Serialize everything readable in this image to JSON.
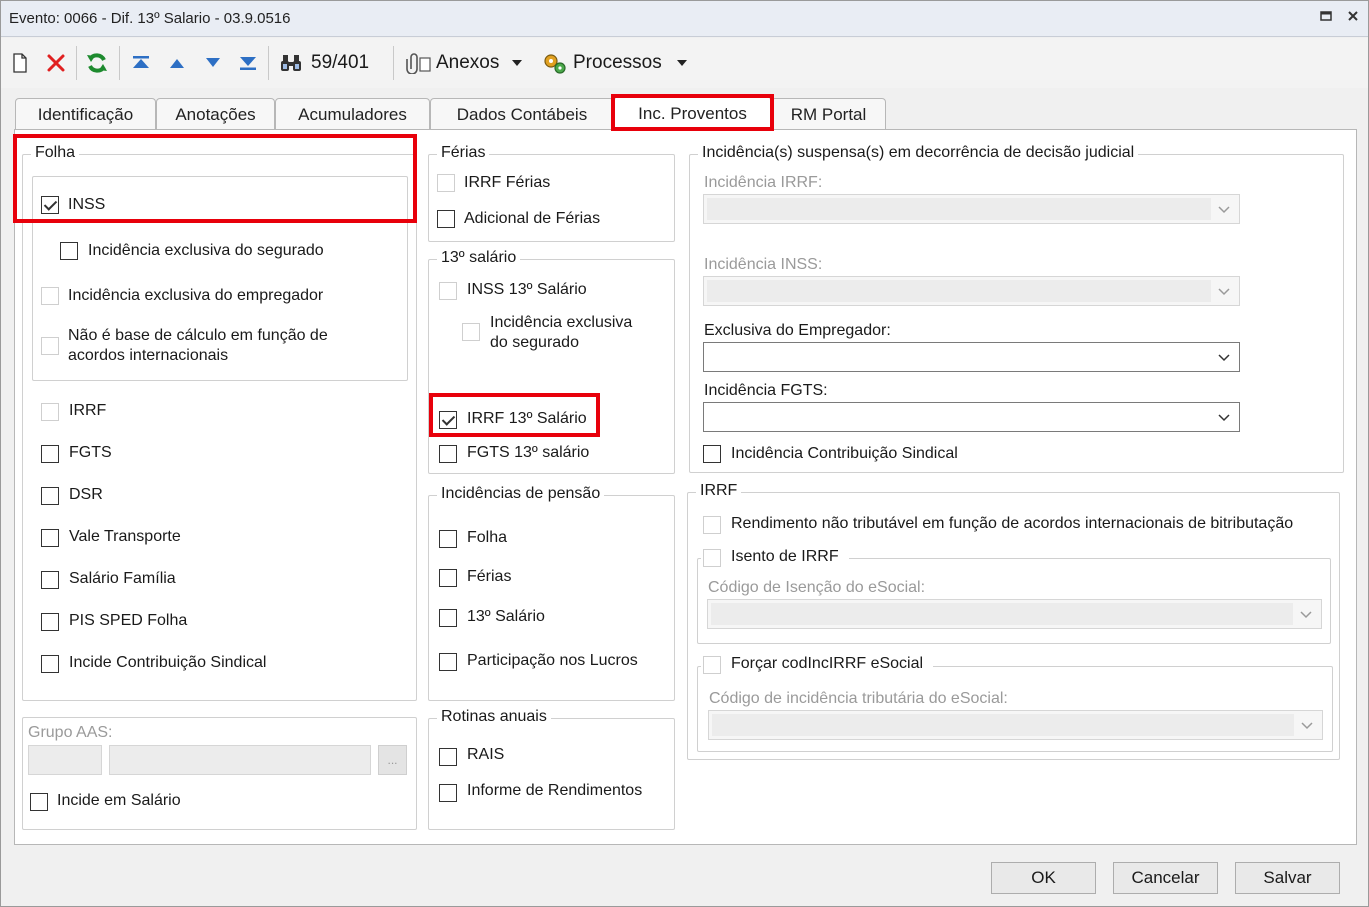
{
  "window": {
    "title": "Evento: 0066 - Dif. 13º Salario - 03.9.0516"
  },
  "toolbar": {
    "record_counter": "59/401",
    "anexos_label": "Anexos",
    "processos_label": "Processos"
  },
  "tabs": [
    {
      "label": "Identificação"
    },
    {
      "label": "Anotações"
    },
    {
      "label": "Acumuladores"
    },
    {
      "label": "Dados Contábeis"
    },
    {
      "label": "Inc. Proventos"
    },
    {
      "label": "RM Portal"
    }
  ],
  "active_tab": "Inc. Proventos",
  "folha": {
    "title": "Folha",
    "inss": {
      "label": "INSS",
      "checked": true
    },
    "inc_exclusiva_segurado": {
      "label": "Incidência exclusiva do segurado",
      "checked": false
    },
    "inc_exclusiva_empregador": {
      "label": "Incidência exclusiva do empregador",
      "checked": false
    },
    "nao_base_calculo": {
      "label": "Não é base de cálculo em função de acordos internacionais",
      "checked": false
    },
    "items": [
      {
        "label": "IRRF",
        "checked": false,
        "enabled": false
      },
      {
        "label": "FGTS",
        "checked": false,
        "enabled": true
      },
      {
        "label": "DSR",
        "checked": false,
        "enabled": true
      },
      {
        "label": "Vale Transporte",
        "checked": false,
        "enabled": true
      },
      {
        "label": "Salário Família",
        "checked": false,
        "enabled": true
      },
      {
        "label": "PIS SPED Folha",
        "checked": false,
        "enabled": true
      },
      {
        "label": "Incide Contribuição Sindical",
        "checked": false,
        "enabled": true
      }
    ]
  },
  "grupo_aas": {
    "label": "Grupo AAS:",
    "browse_label": "...",
    "incide_salario": {
      "label": "Incide em Salário",
      "checked": false
    }
  },
  "ferias": {
    "title": "Férias",
    "irrf_ferias": {
      "label": "IRRF Férias",
      "checked": false
    },
    "adicional_ferias": {
      "label": "Adicional de Férias",
      "checked": false
    }
  },
  "decimo_terceiro": {
    "title": "13º salário",
    "inss_13": {
      "label": "INSS 13º Salário",
      "checked": false
    },
    "inc_exclusiva_segurado": {
      "label": "Incidência exclusiva do segurado",
      "checked": false
    },
    "irrf_13": {
      "label": "IRRF 13º Salário",
      "checked": true
    },
    "fgts_13": {
      "label": "FGTS 13º salário",
      "checked": false
    }
  },
  "pensao": {
    "title": "Incidências de pensão",
    "items": [
      {
        "label": "Folha",
        "checked": false
      },
      {
        "label": "Férias",
        "checked": false
      },
      {
        "label": "13º Salário",
        "checked": false
      },
      {
        "label": "Participação nos Lucros",
        "checked": false
      }
    ]
  },
  "rotinas": {
    "title": "Rotinas anuais",
    "items": [
      {
        "label": "RAIS",
        "checked": false
      },
      {
        "label": "Informe de Rendimentos",
        "checked": false
      }
    ]
  },
  "suspensas": {
    "title": "Incidência(s) suspensa(s) em decorrência de decisão judicial",
    "irrf_label": "Incidência IRRF:",
    "inss_label": "Incidência INSS:",
    "exclusiva_empregador_label": "Exclusiva do Empregador:",
    "fgts_label": "Incidência FGTS:",
    "contrib_sindical": {
      "label": "Incidência Contribuição Sindical",
      "checked": false
    }
  },
  "irrf": {
    "title": "IRRF",
    "rendimento_nao_tributavel": {
      "label": "Rendimento não tributável em função de acordos internacionais de bitributação",
      "checked": false
    },
    "isento": {
      "label": "Isento de IRRF",
      "checked": false
    },
    "codigo_isencao_label": "Código de Isenção do eSocial:",
    "forcar": {
      "label": "Forçar codIncIRRF eSocial",
      "checked": false
    },
    "codigo_incidencia_label": "Código de incidência tributária do eSocial:"
  },
  "footer": {
    "ok_label": "OK",
    "cancel_label": "Cancelar",
    "save_label": "Salvar"
  },
  "colors": {
    "highlight": "#e8000b",
    "accent_blue": "#2d6fc4",
    "delete_red": "#e02020",
    "refresh_green": "#1d8a2e"
  },
  "icons": [
    "new-document-icon",
    "delete-icon",
    "refresh-icon",
    "first-record-icon",
    "previous-record-icon",
    "next-record-icon",
    "last-record-icon",
    "search-binoculars-icon",
    "paperclip-icon",
    "gears-icon",
    "dropdown-arrow-icon",
    "maximize-icon",
    "close-icon",
    "chevron-down-icon"
  ]
}
